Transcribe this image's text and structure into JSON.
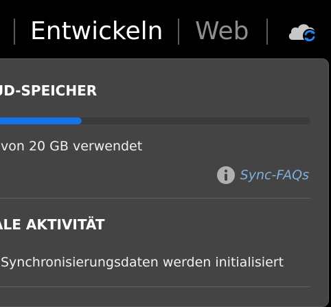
{
  "tabs": [
    {
      "label": "Entwickeln",
      "active": true
    },
    {
      "label": "Web",
      "active": false
    }
  ],
  "icons": {
    "cloud_sync": "cloud-sync-icon",
    "info": "info-icon"
  },
  "colors": {
    "background": "#000000",
    "panel": "#444444",
    "accent": "#1473e6",
    "link": "#7fb0e2"
  },
  "storage": {
    "title": "UD-SPEICHER",
    "progress_fraction": 0.28,
    "usage_text": "von 20 GB verwendet",
    "faq_link": "Sync-FAQs"
  },
  "activity": {
    "title": "ALE AKTIVITÄT",
    "status_text": "Synchronisierungsdaten werden initialisiert"
  }
}
